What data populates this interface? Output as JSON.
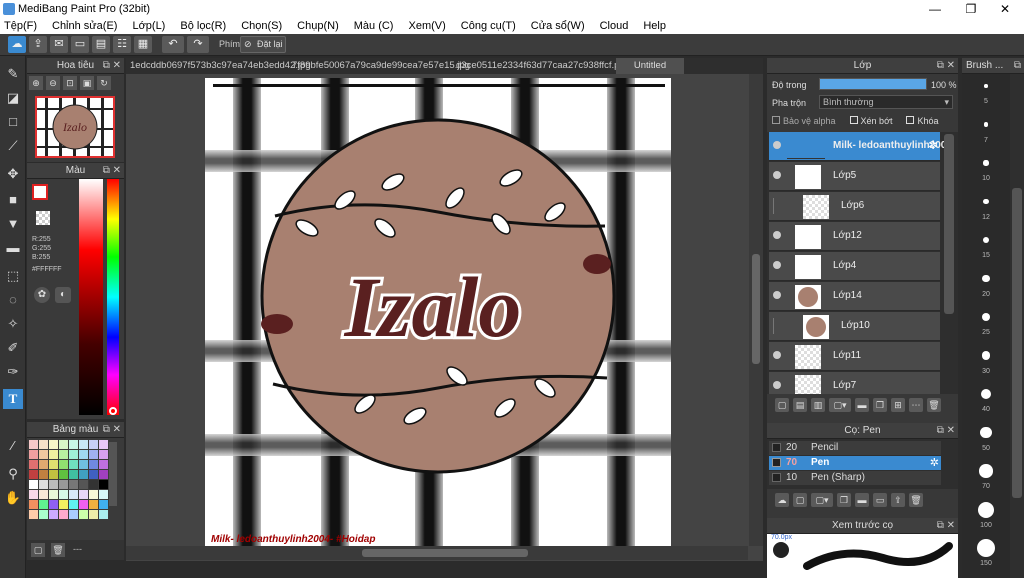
{
  "window": {
    "title": "MediBang Paint Pro (32bit)",
    "minimize": "—",
    "restore": "❐",
    "close": "✕"
  },
  "menu": [
    "Tệp(F)",
    "Chỉnh sửa(E)",
    "Lớp(L)",
    "Bộ lọc(R)",
    "Chọn(S)",
    "Chụp(N)",
    "Màu (C)",
    "Xem(V)",
    "Công cụ(T)",
    "Cửa sổ(W)",
    "Cloud",
    "Help"
  ],
  "toolbar": {
    "phim_label": "Phím",
    "reset_label": "Đặt lại"
  },
  "tabs": [
    "1edcddb0697f573b3c97ea74eb3edd42.jpg",
    "7f89bfe50067a79ca9de99cea7e57e15.jpg",
    "d3ce0511e2334f63d77caa27c938ffcf.png",
    "Untitled"
  ],
  "navigator": {
    "title": "Hoa tiêu"
  },
  "color": {
    "title": "Màu",
    "r": "R:255",
    "g": "G:255",
    "b": "B:255",
    "hex": "#FFFFFF"
  },
  "palette": {
    "title": "Bảng màu",
    "more": "---"
  },
  "canvas": {
    "artwork_text": "Izalo",
    "signature": "Milk- ledoanthuylinh2004- #Hoidap"
  },
  "layers": {
    "title": "Lớp",
    "opacity_label": "Độ trong",
    "opacity_value": "100 %",
    "opacity_fraction": 1.0,
    "blend_label": "Pha trộn",
    "blend_value": "Bình thường",
    "protect_alpha": "Bảo vệ alpha",
    "clip": "Xén bớt",
    "lock": "Khóa",
    "items": [
      {
        "name": "Milk- ledoanthuylinh2004",
        "selected": true
      },
      {
        "name": "Lớp5"
      },
      {
        "name": "Lớp6"
      },
      {
        "name": "Lớp12"
      },
      {
        "name": "Lớp4"
      },
      {
        "name": "Lớp14"
      },
      {
        "name": "Lớp10"
      },
      {
        "name": "Lớp11"
      },
      {
        "name": "Lớp7"
      }
    ]
  },
  "brush_list": {
    "title": "Cọ: Pen",
    "items": [
      {
        "size": "20",
        "name": "Pencil"
      },
      {
        "size": "70",
        "name": "Pen",
        "selected": true
      },
      {
        "size": "10",
        "name": "Pen (Sharp)"
      }
    ]
  },
  "preview": {
    "title": "Xem trước cọ",
    "size": "70.0px"
  },
  "brush_sizes": {
    "title": "Brush ...",
    "sizes": [
      "5",
      "7",
      "10",
      "12",
      "15",
      "20",
      "25",
      "30",
      "40",
      "50",
      "70",
      "100",
      "150"
    ]
  },
  "colors": {
    "accent": "#3a8ad0",
    "dark_brown": "#5a2020",
    "tan": "#a88070"
  }
}
